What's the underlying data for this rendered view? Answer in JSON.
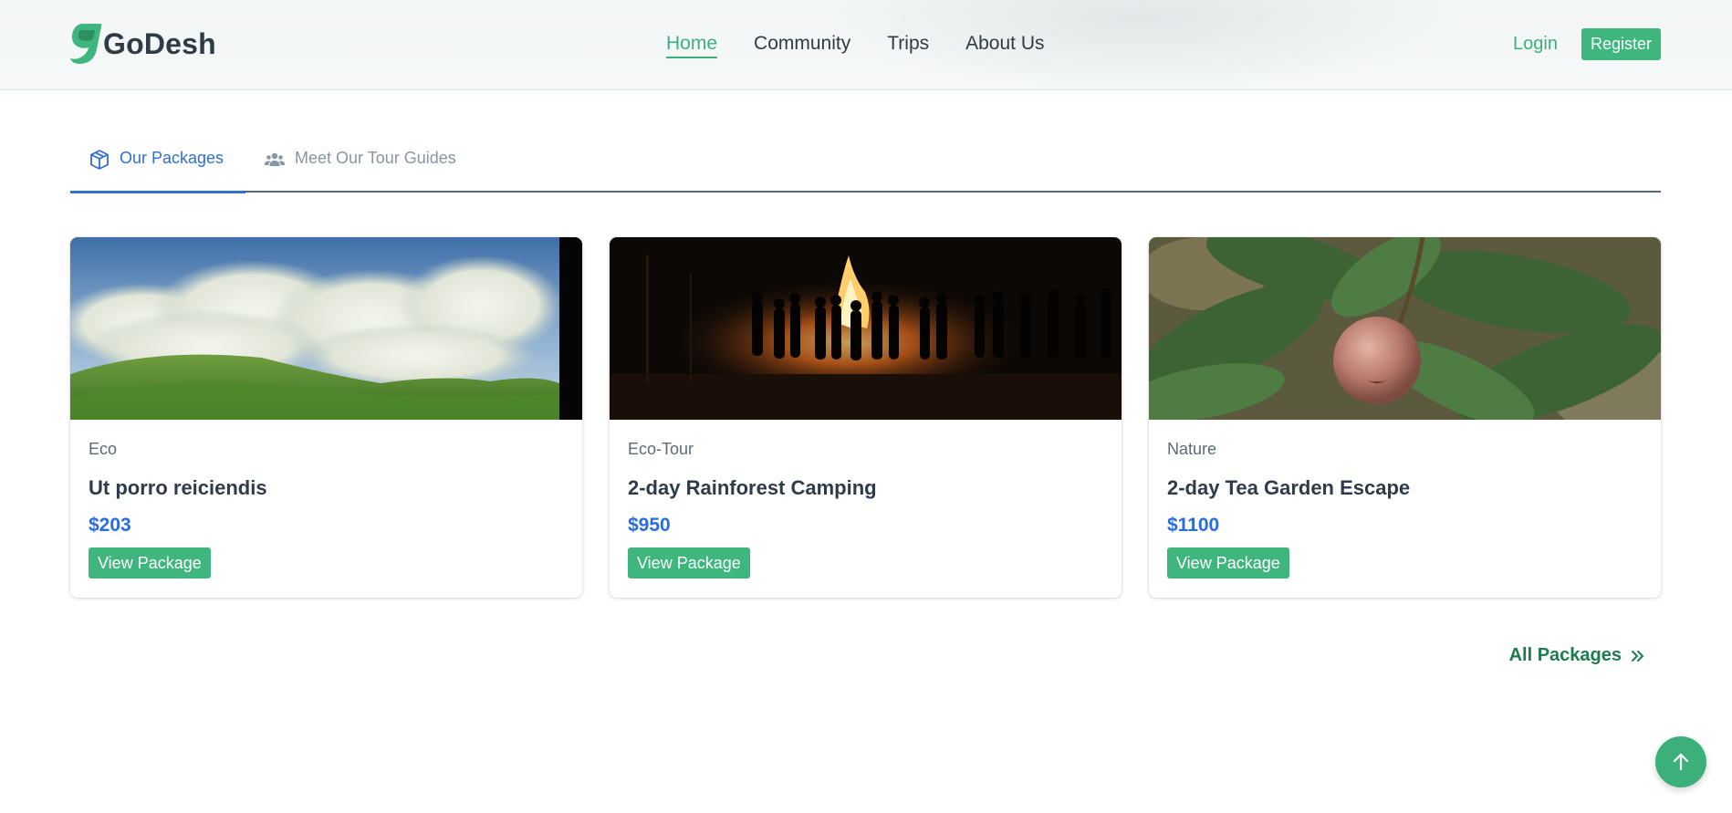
{
  "brand": {
    "name": "GoDesh",
    "color": "#3bb07b"
  },
  "nav": {
    "items": [
      {
        "label": "Home",
        "active": true
      },
      {
        "label": "Community",
        "active": false
      },
      {
        "label": "Trips",
        "active": false
      },
      {
        "label": "About Us",
        "active": false
      }
    ]
  },
  "auth": {
    "login_label": "Login",
    "register_label": "Register"
  },
  "tabs": [
    {
      "label": "Our Packages",
      "icon": "box-icon",
      "active": true
    },
    {
      "label": "Meet Our Tour Guides",
      "icon": "users-icon",
      "active": false
    }
  ],
  "packages": [
    {
      "category": "Eco",
      "title": "Ut porro reiciendis",
      "price": "$203",
      "button": "View Package",
      "image": "green-hills-clouds-image"
    },
    {
      "category": "Eco-Tour",
      "title": "2-day Rainforest Camping",
      "price": "$950",
      "button": "View Package",
      "image": "campfire-night-image"
    },
    {
      "category": "Nature",
      "title": "2-day Tea Garden Escape",
      "price": "$1100",
      "button": "View Package",
      "image": "fruit-leaves-image"
    }
  ],
  "all_packages_label": "All Packages",
  "colors": {
    "accent_green": "#3fb67e",
    "tab_blue": "#2f6fd6",
    "price_blue": "#2a6be0",
    "link_green": "#1f7a4f"
  }
}
